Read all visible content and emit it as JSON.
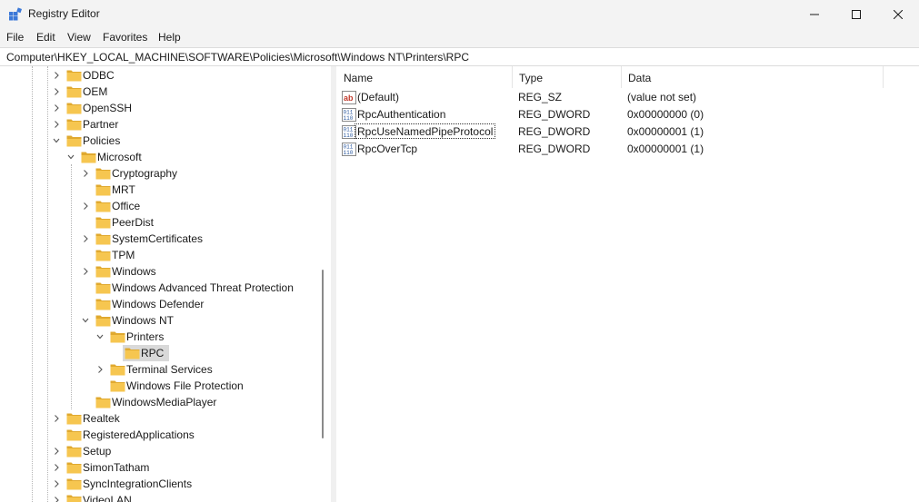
{
  "window": {
    "title": "Registry Editor"
  },
  "menu": [
    "File",
    "Edit",
    "View",
    "Favorites",
    "Help"
  ],
  "address": "Computer\\HKEY_LOCAL_MACHINE\\SOFTWARE\\Policies\\Microsoft\\Windows NT\\Printers\\RPC",
  "tree": [
    {
      "label": "ODBC",
      "level": 0,
      "expander": "collapsed"
    },
    {
      "label": "OEM",
      "level": 0,
      "expander": "collapsed"
    },
    {
      "label": "OpenSSH",
      "level": 0,
      "expander": "collapsed"
    },
    {
      "label": "Partner",
      "level": 0,
      "expander": "collapsed"
    },
    {
      "label": "Policies",
      "level": 0,
      "expander": "expanded"
    },
    {
      "label": "Microsoft",
      "level": 1,
      "expander": "expanded"
    },
    {
      "label": "Cryptography",
      "level": 2,
      "expander": "collapsed"
    },
    {
      "label": "MRT",
      "level": 2,
      "expander": "none"
    },
    {
      "label": "Office",
      "level": 2,
      "expander": "collapsed"
    },
    {
      "label": "PeerDist",
      "level": 2,
      "expander": "none"
    },
    {
      "label": "SystemCertificates",
      "level": 2,
      "expander": "collapsed"
    },
    {
      "label": "TPM",
      "level": 2,
      "expander": "none"
    },
    {
      "label": "Windows",
      "level": 2,
      "expander": "collapsed"
    },
    {
      "label": "Windows Advanced Threat Protection",
      "level": 2,
      "expander": "none"
    },
    {
      "label": "Windows Defender",
      "level": 2,
      "expander": "none"
    },
    {
      "label": "Windows NT",
      "level": 2,
      "expander": "expanded"
    },
    {
      "label": "Printers",
      "level": 3,
      "expander": "expanded"
    },
    {
      "label": "RPC",
      "level": 4,
      "expander": "none",
      "selected": true
    },
    {
      "label": "Terminal Services",
      "level": 3,
      "expander": "collapsed"
    },
    {
      "label": "Windows File Protection",
      "level": 3,
      "expander": "none"
    },
    {
      "label": "WindowsMediaPlayer",
      "level": 2,
      "expander": "none"
    },
    {
      "label": "Realtek",
      "level": 0,
      "expander": "collapsed"
    },
    {
      "label": "RegisteredApplications",
      "level": 0,
      "expander": "none"
    },
    {
      "label": "Setup",
      "level": 0,
      "expander": "collapsed"
    },
    {
      "label": "SimonTatham",
      "level": 0,
      "expander": "collapsed"
    },
    {
      "label": "SyncIntegrationClients",
      "level": 0,
      "expander": "collapsed"
    },
    {
      "label": "VideoLAN",
      "level": 0,
      "expander": "collapsed"
    }
  ],
  "list": {
    "columns": [
      "Name",
      "Type",
      "Data"
    ],
    "rows": [
      {
        "name": "(Default)",
        "type": "REG_SZ",
        "data": "(value not set)",
        "icon": "string-value-icon"
      },
      {
        "name": "RpcAuthentication",
        "type": "REG_DWORD",
        "data": "0x00000000 (0)",
        "icon": "dword-value-icon"
      },
      {
        "name": "RpcUseNamedPipeProtocol",
        "type": "REG_DWORD",
        "data": "0x00000001 (1)",
        "icon": "dword-value-icon",
        "focused": true
      },
      {
        "name": "RpcOverTcp",
        "type": "REG_DWORD",
        "data": "0x00000001 (1)",
        "icon": "dword-value-icon"
      }
    ]
  },
  "colors": {
    "folder": "#f6c650",
    "folder_dark": "#e0a92f",
    "selection": "#d9d9d9",
    "dword_blue": "#2c5aa0",
    "string_red": "#c0392b"
  }
}
